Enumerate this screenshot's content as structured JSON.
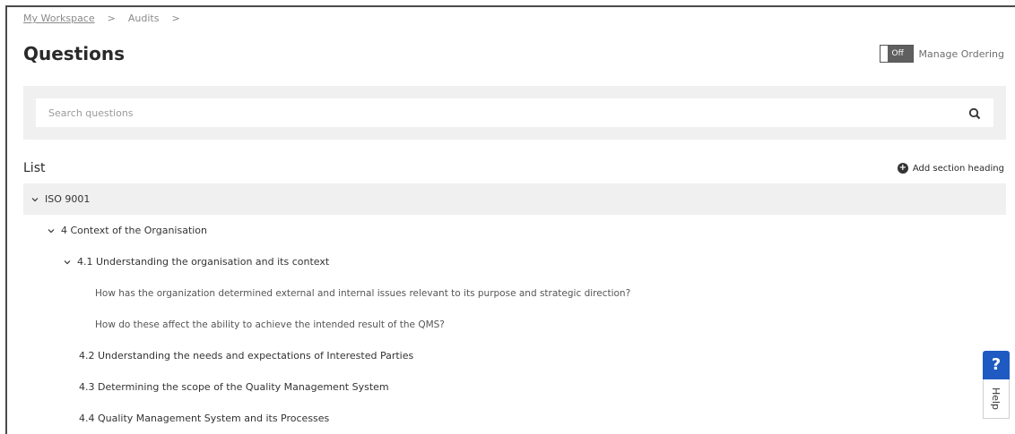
{
  "breadcrumb": {
    "items": [
      "My Workspace",
      "Audits"
    ],
    "separator": ">"
  },
  "page": {
    "title": "Questions"
  },
  "ordering": {
    "toggle_state": "Off",
    "label": "Manage Ordering"
  },
  "search": {
    "placeholder": "Search questions",
    "value": ""
  },
  "list": {
    "title": "List",
    "add_label": "Add section heading",
    "rows": [
      {
        "text": "ISO 9001",
        "type": "section",
        "expanded": true
      },
      {
        "text": "4 Context of the Organisation",
        "type": "section",
        "expanded": true
      },
      {
        "text": "4.1 Understanding the organisation and its context",
        "type": "section",
        "expanded": true
      },
      {
        "text": "How has the organization determined external and internal issues relevant to its purpose and strategic direction?",
        "type": "question"
      },
      {
        "text": "How do these affect the ability to achieve the intended result of the QMS?",
        "type": "question"
      },
      {
        "text": "4.2 Understanding the needs and expectations of Interested Parties",
        "type": "section",
        "expanded": false
      },
      {
        "text": "4.3 Determining the scope of the Quality Management System",
        "type": "section",
        "expanded": false
      },
      {
        "text": "4.4 Quality Management System and its Processes",
        "type": "section",
        "expanded": false
      }
    ]
  },
  "help": {
    "symbol": "?",
    "label": "Help"
  },
  "colors": {
    "accent": "#1e5ac2",
    "panel": "#f0f0f0"
  }
}
